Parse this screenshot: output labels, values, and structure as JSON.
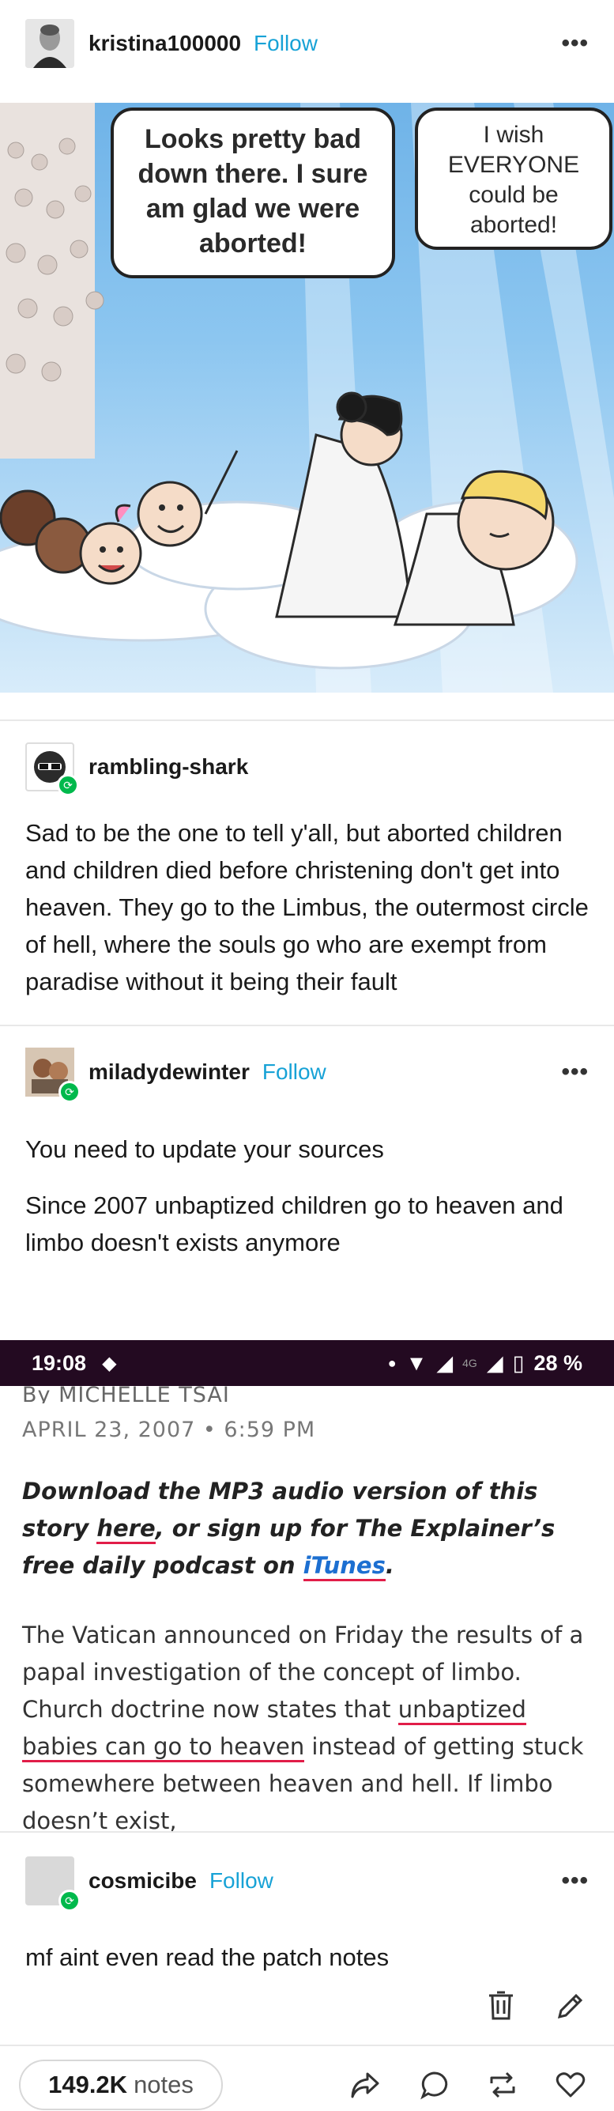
{
  "post": {
    "author": {
      "name": "kristina100000",
      "follow_label": "Follow",
      "more_label": "•••"
    },
    "image": {
      "bubble_left": "Looks pretty bad down there. I sure am glad we were aborted!",
      "bubble_right": "I wish EVERYONE could be aborted!"
    }
  },
  "reblogs": [
    {
      "name": "rambling-shark",
      "text": "Sad to be the one to tell y'all, but aborted children and children died before christening don't get into heaven. They go to the Limbus, the outermost circle of hell, where the souls go who are exempt from paradise without it being their fault"
    },
    {
      "name": "miladydewinter",
      "follow_label": "Follow",
      "more_label": "•••",
      "paragraphs": [
        "You need to update your sources",
        "Since 2007 unbaptized children go to heaven and limbo doesn't exists anymore"
      ],
      "screenshot": {
        "status_time": "19:08",
        "status_network": "4G",
        "status_battery": "28 %",
        "byline": "By MICHELLE TSAI",
        "date": "APRIL 23, 2007 • 6:59 PM",
        "promo_a": "Download the MP3 audio version of this story ",
        "promo_link1": "here",
        "promo_b": ", or sign up for The Explainer’s free daily podcast on ",
        "promo_link2": "iTunes",
        "promo_c": ".",
        "body_a": "The Vatican announced on Friday the results of a papal investigation of the concept of limbo. Church doctrine now states that ",
        "body_link": "unbaptized babies can go to heaven",
        "body_b": " instead of getting stuck somewhere between heaven and hell. If limbo doesn’t exist,"
      }
    },
    {
      "name": "cosmicibe",
      "follow_label": "Follow",
      "more_label": "•••",
      "text": "mf aint even read the patch notes"
    }
  ],
  "footer": {
    "notes_count": "149.2K",
    "notes_label": "notes",
    "icons": [
      "trash-icon",
      "edit-icon",
      "share-icon",
      "reply-icon",
      "reblog-icon",
      "like-icon"
    ]
  },
  "colors": {
    "follow": "#17a2d6",
    "reblog_badge": "#00b94c",
    "status_bar": "#230a21",
    "underline": "#e11d48",
    "link": "#1c6fd1"
  }
}
